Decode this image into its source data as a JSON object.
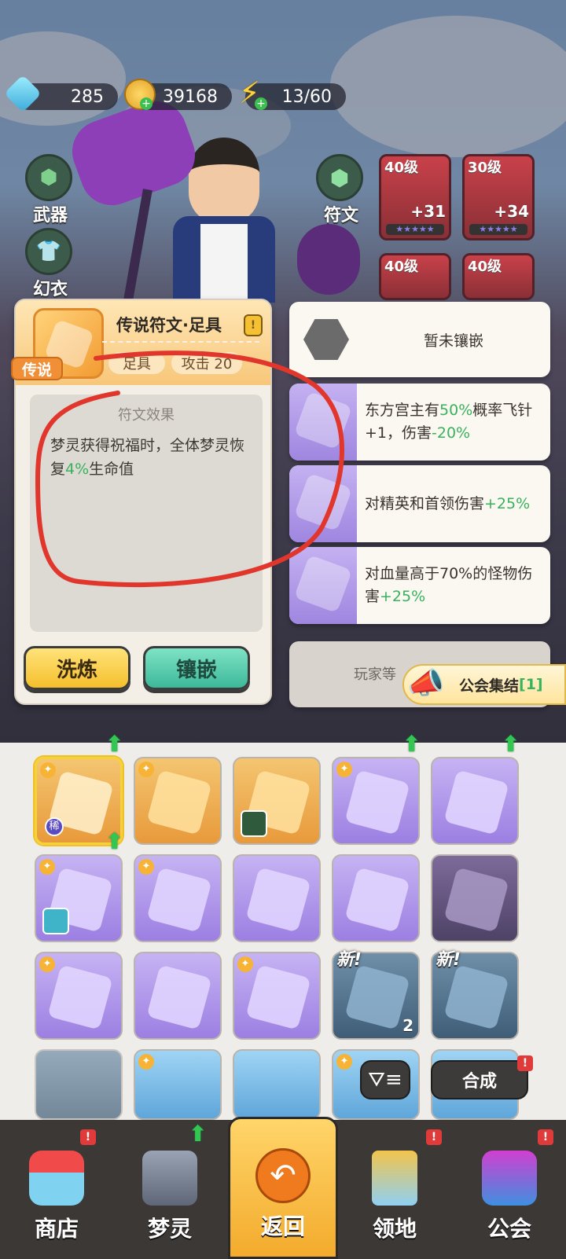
{
  "currency": {
    "gems": "285",
    "coins": "39168",
    "energy": "13/60"
  },
  "left_equip": [
    {
      "label": "武器"
    },
    {
      "label": "幻衣"
    }
  ],
  "rune_entry": {
    "label": "符文"
  },
  "equip_slots": [
    {
      "level": "40级",
      "count": "+31"
    },
    {
      "level": "30级",
      "count": "+34"
    },
    {
      "level": "40级",
      "count": ""
    },
    {
      "level": "40级",
      "count": ""
    }
  ],
  "rune_panel": {
    "title": "传说符文·足具",
    "rarity_tag": "传说",
    "type_pill": "足具",
    "stat_pill": "攻击 20",
    "effect_title": "符文效果",
    "effect_parts": [
      "梦灵获得祝福时，全体梦灵恢复",
      "4%",
      "生命值"
    ],
    "refine_button": "洗炼",
    "inlay_button": "镶嵌"
  },
  "right_list": {
    "empty_label": "暂未镶嵌",
    "items": [
      {
        "parts": [
          "东方宫主有",
          "50%",
          "概率飞针+1，伤害",
          "-20%"
        ]
      },
      {
        "parts": [
          "对精英和首领伤害",
          "+25%",
          "",
          ""
        ]
      },
      {
        "parts": [
          "对血量高于70%的怪物伤害",
          "+25%",
          "",
          ""
        ]
      }
    ],
    "locked_label": "玩家等",
    "guild_rally": "公会集结",
    "guild_rally_count": "[1]"
  },
  "inventory": {
    "rare_badge": "稀",
    "new_tag": "新!",
    "stack_count": "2",
    "synth_button": "合成",
    "badge_mark": "!"
  },
  "nav": [
    {
      "label": "商店"
    },
    {
      "label": "梦灵"
    },
    {
      "label": "返回"
    },
    {
      "label": "领地"
    },
    {
      "label": "公会"
    }
  ],
  "colors": {
    "green_value": "#38b25c",
    "legend_orange": "#f08f35",
    "rune_purple": "#9c7fe2"
  }
}
